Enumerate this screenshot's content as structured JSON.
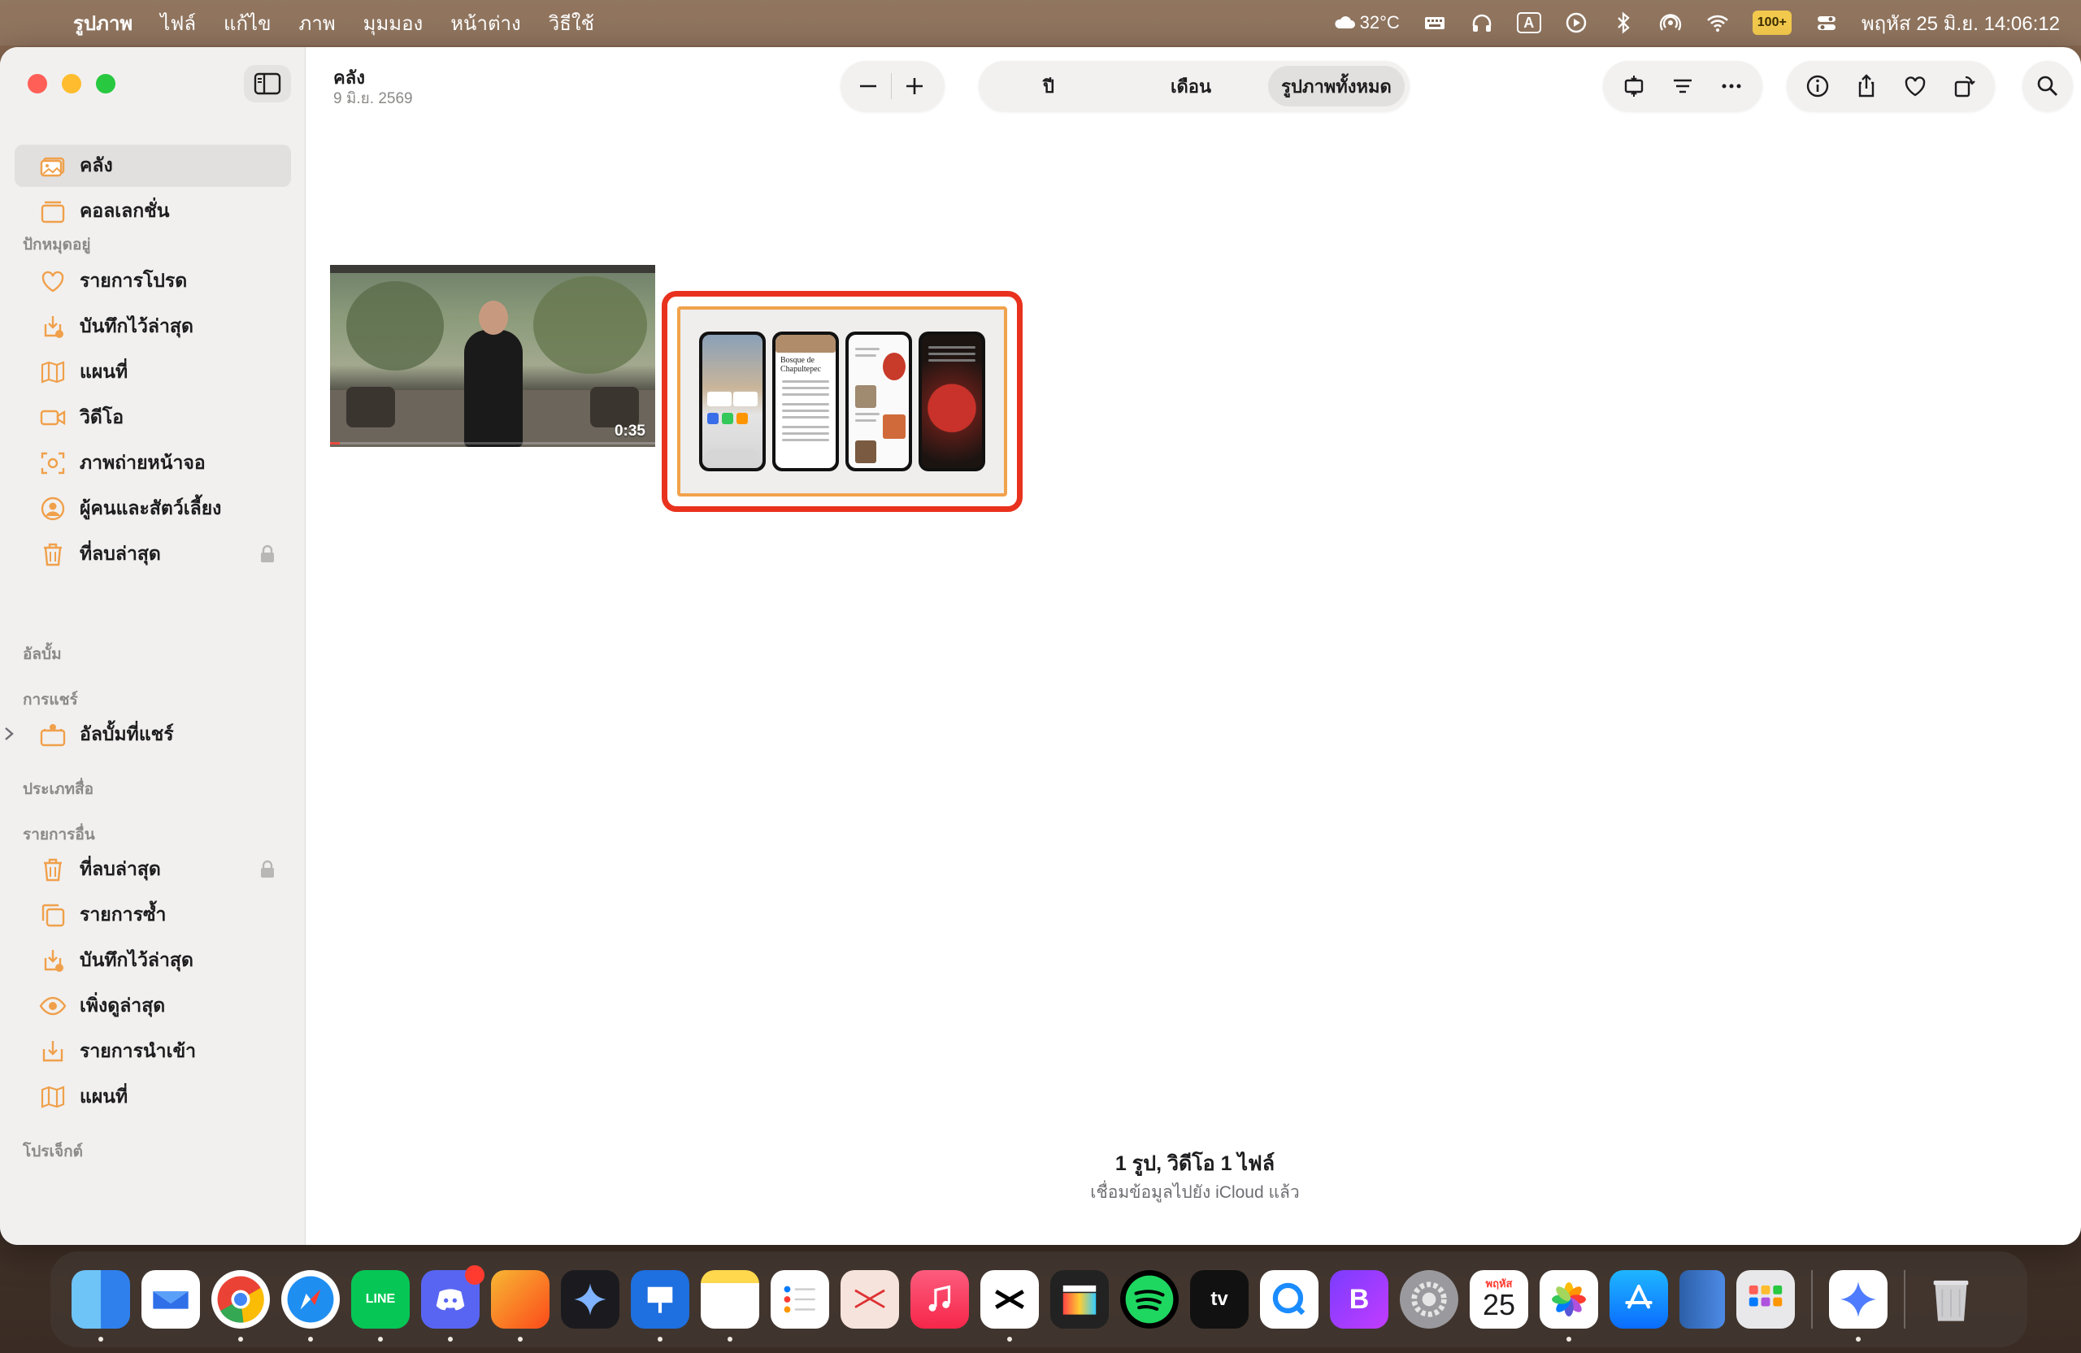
{
  "menubar": {
    "app_name": "รูปภาพ",
    "menus": [
      "ไฟล์",
      "แก้ไข",
      "ภาพ",
      "มุมมอง",
      "หน้าต่าง",
      "วิธีใช้"
    ],
    "weather": "32°C",
    "battery": "100+",
    "input_indicator": "A",
    "clock": "พฤหัส 25 มิ.ย.  14:06:12"
  },
  "sidebar": {
    "main_items": [
      {
        "label": "คลัง",
        "icon": "library-icon",
        "active": true
      },
      {
        "label": "คอลเลกชั่น",
        "icon": "collections-icon"
      }
    ],
    "pinned_header": "ปักหมุดอยู่",
    "pinned_items": [
      {
        "label": "รายการโปรด",
        "icon": "heart-icon"
      },
      {
        "label": "บันทึกไว้ล่าสุด",
        "icon": "recently-saved-icon"
      },
      {
        "label": "แผนที่",
        "icon": "map-icon"
      },
      {
        "label": "วิดีโอ",
        "icon": "video-icon"
      },
      {
        "label": "ภาพถ่ายหน้าจอ",
        "icon": "screenshot-icon"
      },
      {
        "label": "ผู้คนและสัตว์เลี้ยง",
        "icon": "people-icon"
      },
      {
        "label": "ที่ลบล่าสุด",
        "icon": "trash-icon",
        "locked": true
      }
    ],
    "albums_header": "อัลบั้ม",
    "sharing_header": "การแชร์",
    "sharing_items": [
      {
        "label": "อัลบั้มที่แชร์",
        "icon": "shared-albums-icon"
      }
    ],
    "media_types_header": "ประเภทสื่อ",
    "other_header": "รายการอื่น",
    "other_items": [
      {
        "label": "ที่ลบล่าสุด",
        "icon": "trash-icon",
        "locked": true
      },
      {
        "label": "รายการซ้ำ",
        "icon": "duplicates-icon"
      },
      {
        "label": "บันทึกไว้ล่าสุด",
        "icon": "recently-saved-icon"
      },
      {
        "label": "เพิ่งดูล่าสุด",
        "icon": "eye-icon"
      },
      {
        "label": "รายการนำเข้า",
        "icon": "import-icon"
      },
      {
        "label": "แผนที่",
        "icon": "map-icon"
      }
    ],
    "projects_header": "โปรเจ็กต์"
  },
  "main": {
    "title": "คลัง",
    "date": "9 มิ.ย. 2569",
    "view_segments": [
      {
        "label": "ปี",
        "active": false
      },
      {
        "label": "เดือน",
        "active": false
      },
      {
        "label": "รูปภาพทั้งหมด",
        "active": true
      }
    ],
    "video_duration": "0:35",
    "video_progress": 0.03,
    "count_summary": "1 รูป, วิดีโอ 1 ไฟล์",
    "sync_status": "เชื่อมข้อมูลไปยัง iCloud แล้ว",
    "phone_preview_title": "Bosque de Chapultepec"
  },
  "colors": {
    "accent": "#f0a04b",
    "selection": "#e8321e",
    "sidebar_bg": "#f1f0ef"
  },
  "dock": {
    "calendar_month": "พฤหัส",
    "calendar_day": "25",
    "apps": [
      "finder-icon",
      "mail-icon",
      "chrome-icon",
      "safari-icon",
      "line-icon",
      "discord-icon",
      "pages-icon",
      "gemini-icon",
      "keynote-icon",
      "notes-icon",
      "reminders-icon",
      "wadai-icon",
      "music-icon",
      "capcut-icon",
      "final-cut-icon",
      "spotify-icon",
      "apple-tv-icon",
      "quick-icon",
      "bbedit-icon",
      "system-settings-icon",
      "calendar-icon",
      "photos-icon",
      "app-store-icon",
      "files-icon",
      "launchpad-icon",
      "ai-assistant-icon",
      "trash-icon"
    ]
  }
}
